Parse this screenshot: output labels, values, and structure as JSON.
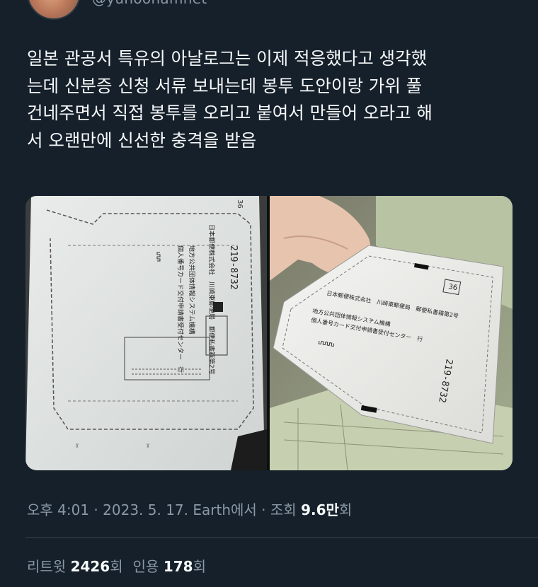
{
  "header": {
    "handle": "@yunoonamnet"
  },
  "tweet": {
    "lines": [
      "일본 관공서 특유의 아날로그는 이제 적응했다고 생각했",
      "는데 신분증 신청 서류 보내는데 봉투 도안이랑 가위 풀",
      "건네주면서 직접 봉투를 오리고 붙여서 만들어 오라고 해",
      "서 오랜만에 신선한 충격을 받음"
    ]
  },
  "media": {
    "left_photo": {
      "postcode": "219-8732",
      "address_1": "日本郵便株式会社　川崎東郵便局　郵便私書箱第2号",
      "address_2": "地方公共団体情報システム機構",
      "address_3": "個人番号カード交付申請書受付センター　行",
      "box_no": "36"
    },
    "right_photo": {
      "postcode": "219-8732",
      "address_1": "日本郵便株式会社　川崎東郵便局　郵便私書箱第2号",
      "address_2": "地方公共団体情報システム機構",
      "address_3": "個人番号カード交付申請書受付センター　行",
      "box_no": "36"
    }
  },
  "meta": {
    "time": "오후 4:01",
    "sep1": " · ",
    "date": "2023. 5. 17.",
    "source": " Earth에서",
    "sep2": " · ",
    "views_label": "조회 ",
    "views_value": "9.6만",
    "views_suffix": "회"
  },
  "stats": {
    "retweets_label": "리트윗 ",
    "retweets_value": "2426",
    "retweets_suffix": "회",
    "quotes_label": "인용 ",
    "quotes_value": "178",
    "quotes_suffix": "회"
  },
  "colors": {
    "background": "#15202b",
    "text_primary": "#f7f9f9",
    "text_secondary": "#8b98a5",
    "divider": "#38444d"
  }
}
